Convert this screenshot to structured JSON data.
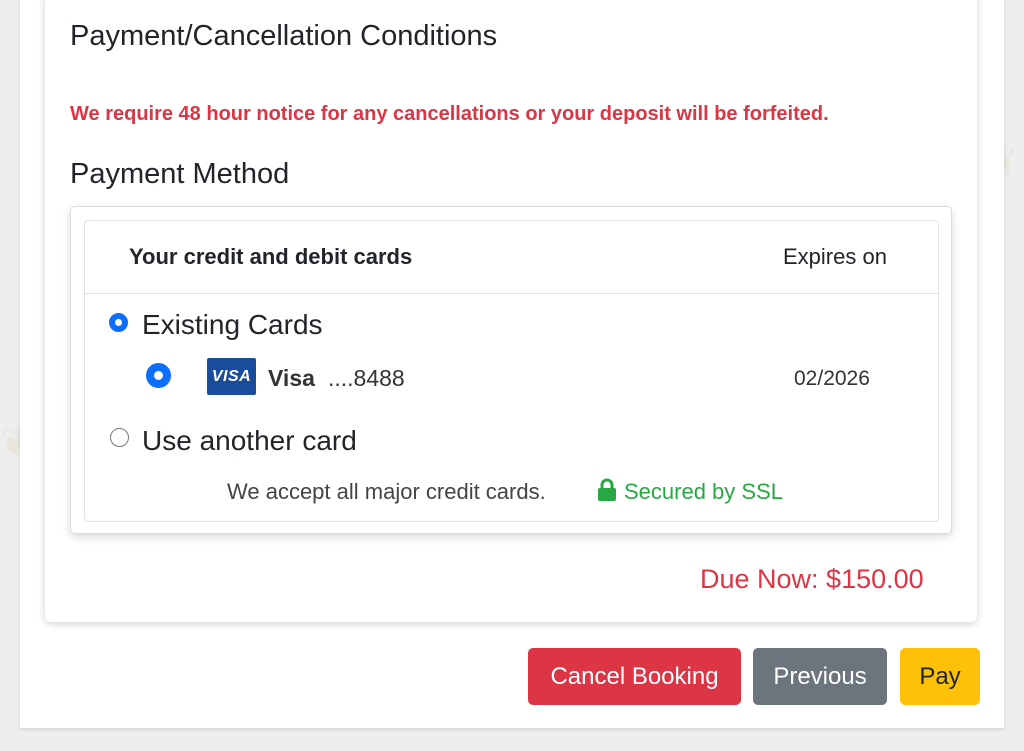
{
  "conditions": {
    "title": "Payment/Cancellation Conditions",
    "warning": "We require 48 hour notice for any cancellations or your deposit will be forfeited."
  },
  "payment_method": {
    "title": "Payment Method",
    "header_cards": "Your credit and debit cards",
    "header_expires": "Expires on",
    "existing_label": "Existing Cards",
    "card": {
      "brand_logo": "VISA",
      "brand": "Visa",
      "number": "....8488",
      "expiry": "02/2026",
      "selected": true
    },
    "another_label": "Use another card",
    "accept_text": "We accept all major credit cards.",
    "secured_text": "Secured by SSL"
  },
  "due_now": "Due Now: $150.00",
  "buttons": {
    "cancel": "Cancel Booking",
    "previous": "Previous",
    "pay": "Pay"
  },
  "colors": {
    "danger": "#dc3545",
    "secondary": "#6c757d",
    "warning": "#ffc107",
    "success": "#28a745",
    "primary": "#0d6efd",
    "visa": "#1a4c9c"
  },
  "icons": {
    "radio": "radio-icon",
    "lock": "lock-icon",
    "visa": "visa-logo-icon",
    "background": "paw-print-icon"
  }
}
